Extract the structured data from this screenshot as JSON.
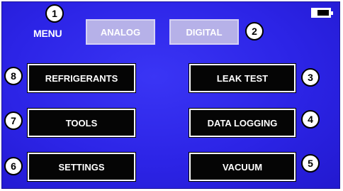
{
  "header": {
    "menu_label": "MENU",
    "tabs": [
      {
        "label": "ANALOG"
      },
      {
        "label": "DIGITAL"
      }
    ]
  },
  "battery": {
    "level": 0.65
  },
  "buttons": {
    "refrigerants": "REFRIGERANTS",
    "tools": "TOOLS",
    "settings": "SETTINGS",
    "leak_test": "LEAK TEST",
    "data_logging": "DATA LOGGING",
    "vacuum": "VACUUM"
  },
  "callouts": [
    "1",
    "2",
    "3",
    "4",
    "5",
    "6",
    "7",
    "8"
  ]
}
